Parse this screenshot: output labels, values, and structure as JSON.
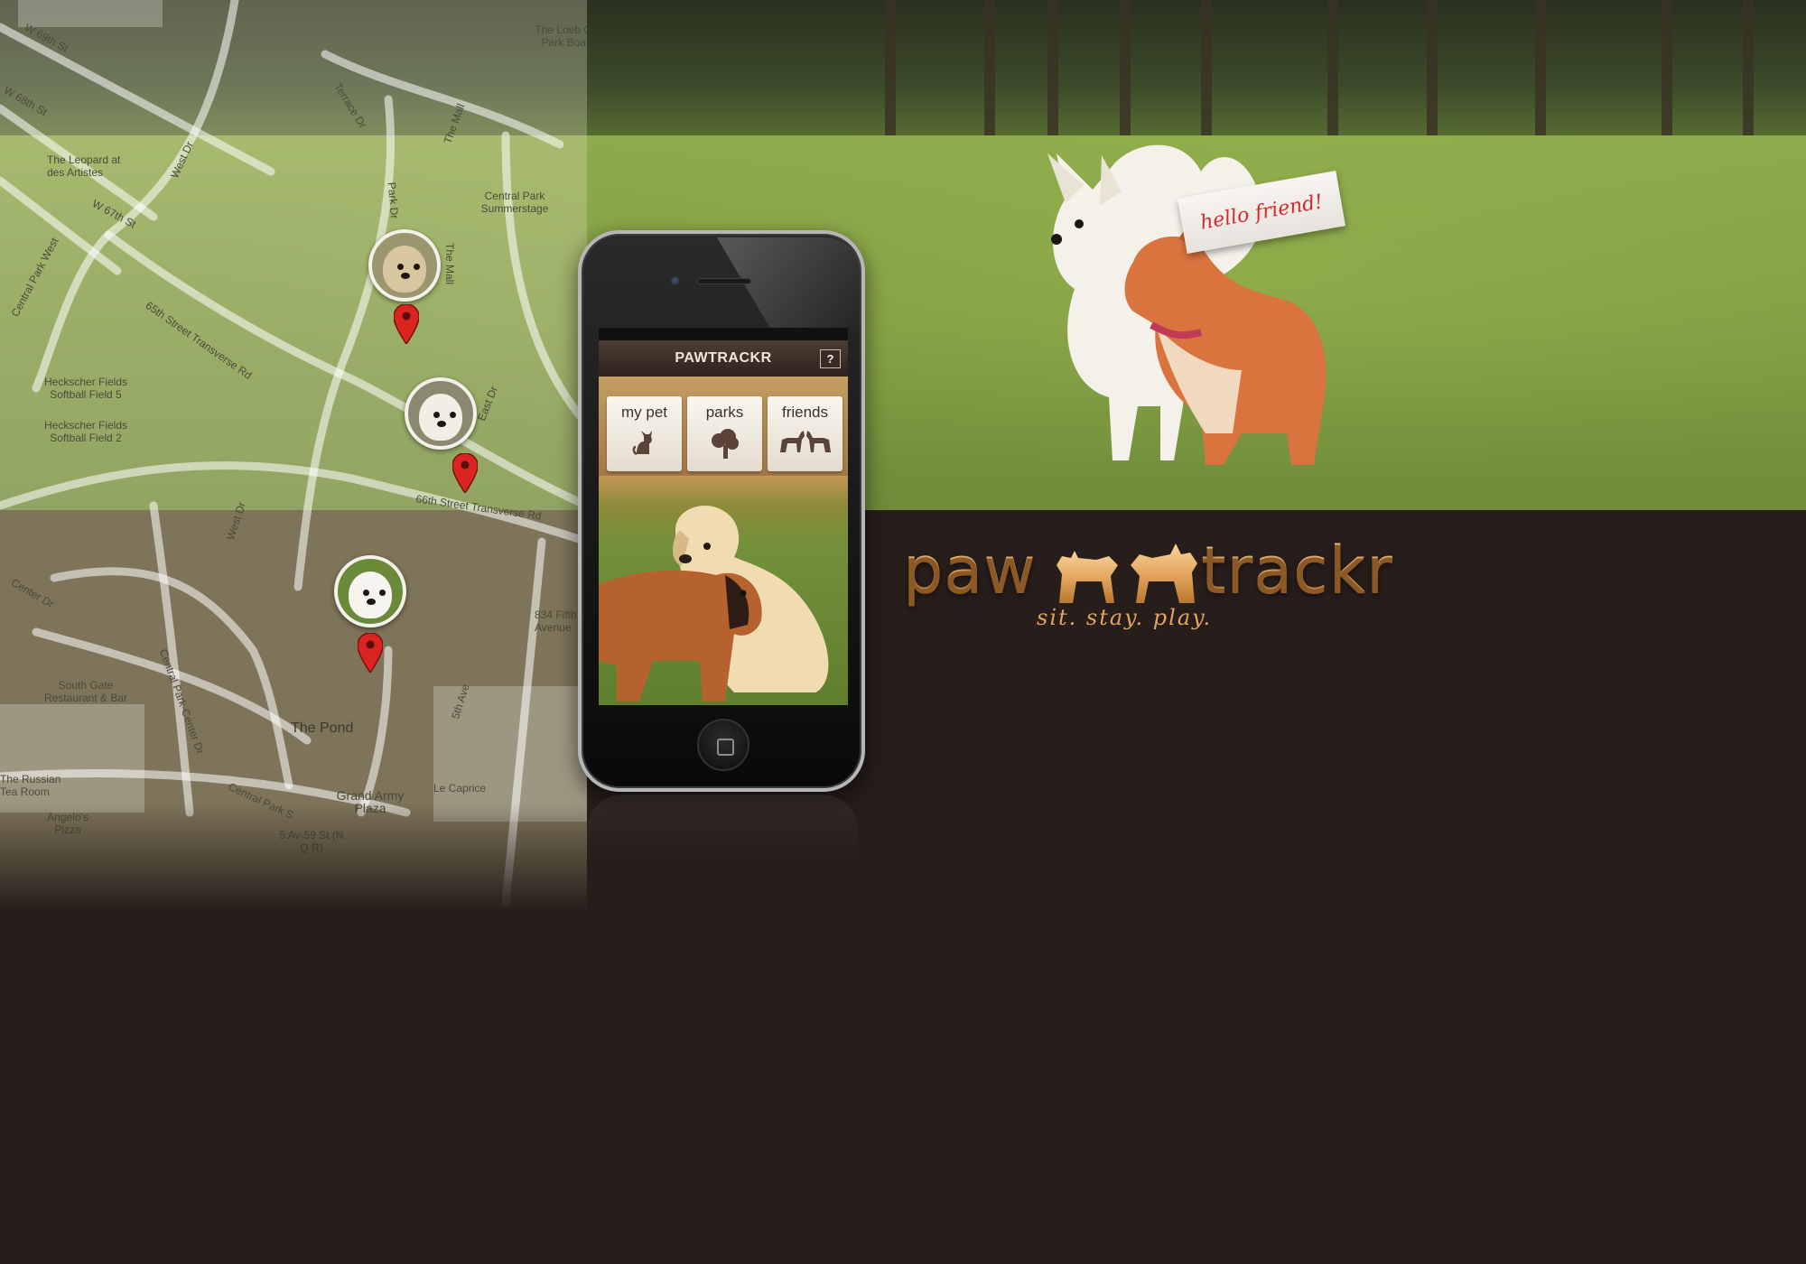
{
  "map": {
    "streets": [
      "W 69th St",
      "W 68th St",
      "W 67th St",
      "West Dr",
      "Terrace Dr",
      "The Mall",
      "Central Park West",
      "66th Street Transverse Rd",
      "65th Street Transverse Rd",
      "East Dr",
      "Center Dr",
      "Central Park-Center Dr",
      "Central Park S",
      "5th Ave",
      "Park Dr",
      "The Mall",
      "West Dr"
    ],
    "places": [
      "The Loeb Central Park Boathouse",
      "The Leopard at des Artistes",
      "Central Park Summerstage",
      "Heckscher Fields Softball Field 5",
      "Heckscher Fields Softball Field 2",
      "South Gate Restaurant & Bar",
      "The Pond",
      "The Russian Tea Room",
      "Angelo's Pizza",
      "Grand Army Plaza",
      "Le Caprice",
      "5 Av-59 St (N Q R)",
      "834 Fifth Avenue"
    ]
  },
  "note": {
    "text": "hello friend!"
  },
  "phone": {
    "app_title": "PAWTRACKR",
    "help_label": "?",
    "menu": [
      {
        "label": "my pet",
        "icon": "cat-icon"
      },
      {
        "label": "parks",
        "icon": "tree-icon"
      },
      {
        "label": "friends",
        "icon": "dogs-icon"
      }
    ]
  },
  "logo": {
    "word1": "paw",
    "word2": "trackr",
    "tagline": "sit. stay. play."
  },
  "colors": {
    "background": "#271d1a",
    "accent": "#e2a35b",
    "pin": "#d9241f",
    "note_text": "#d6292a"
  }
}
